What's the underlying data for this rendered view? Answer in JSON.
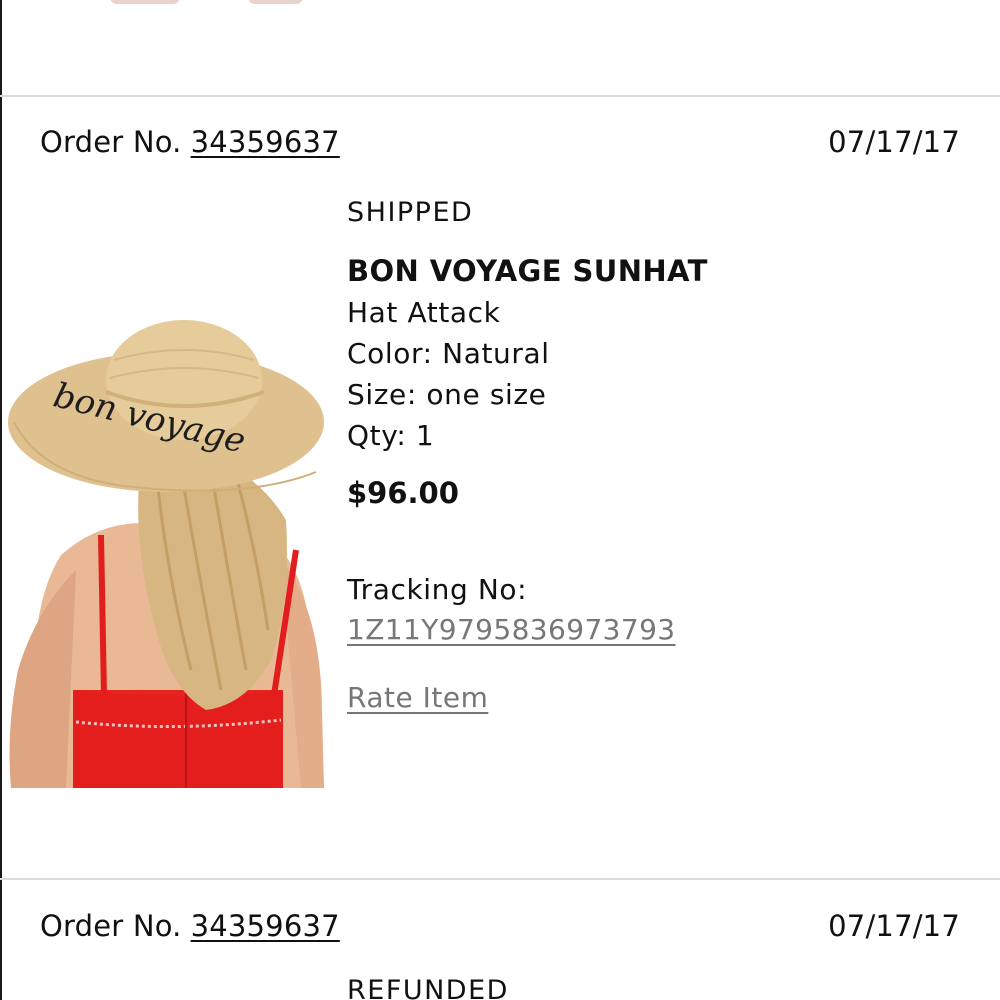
{
  "orders": [
    {
      "label": "Order No.",
      "number": "34359637",
      "date": "07/17/17",
      "status": "SHIPPED",
      "product": {
        "title": "BON VOYAGE SUNHAT",
        "brand": "Hat Attack",
        "color": "Color: Natural",
        "size": "Size: one size",
        "qty": "Qty: 1",
        "price": "$96.00",
        "image_text": "bon voyage"
      },
      "tracking_label": "Tracking No:",
      "tracking_number": "1Z11Y9795836973793",
      "rate_label": "Rate Item"
    },
    {
      "label": "Order No.",
      "number": "34359637",
      "date": "07/17/17",
      "status": "REFUNDED"
    }
  ]
}
